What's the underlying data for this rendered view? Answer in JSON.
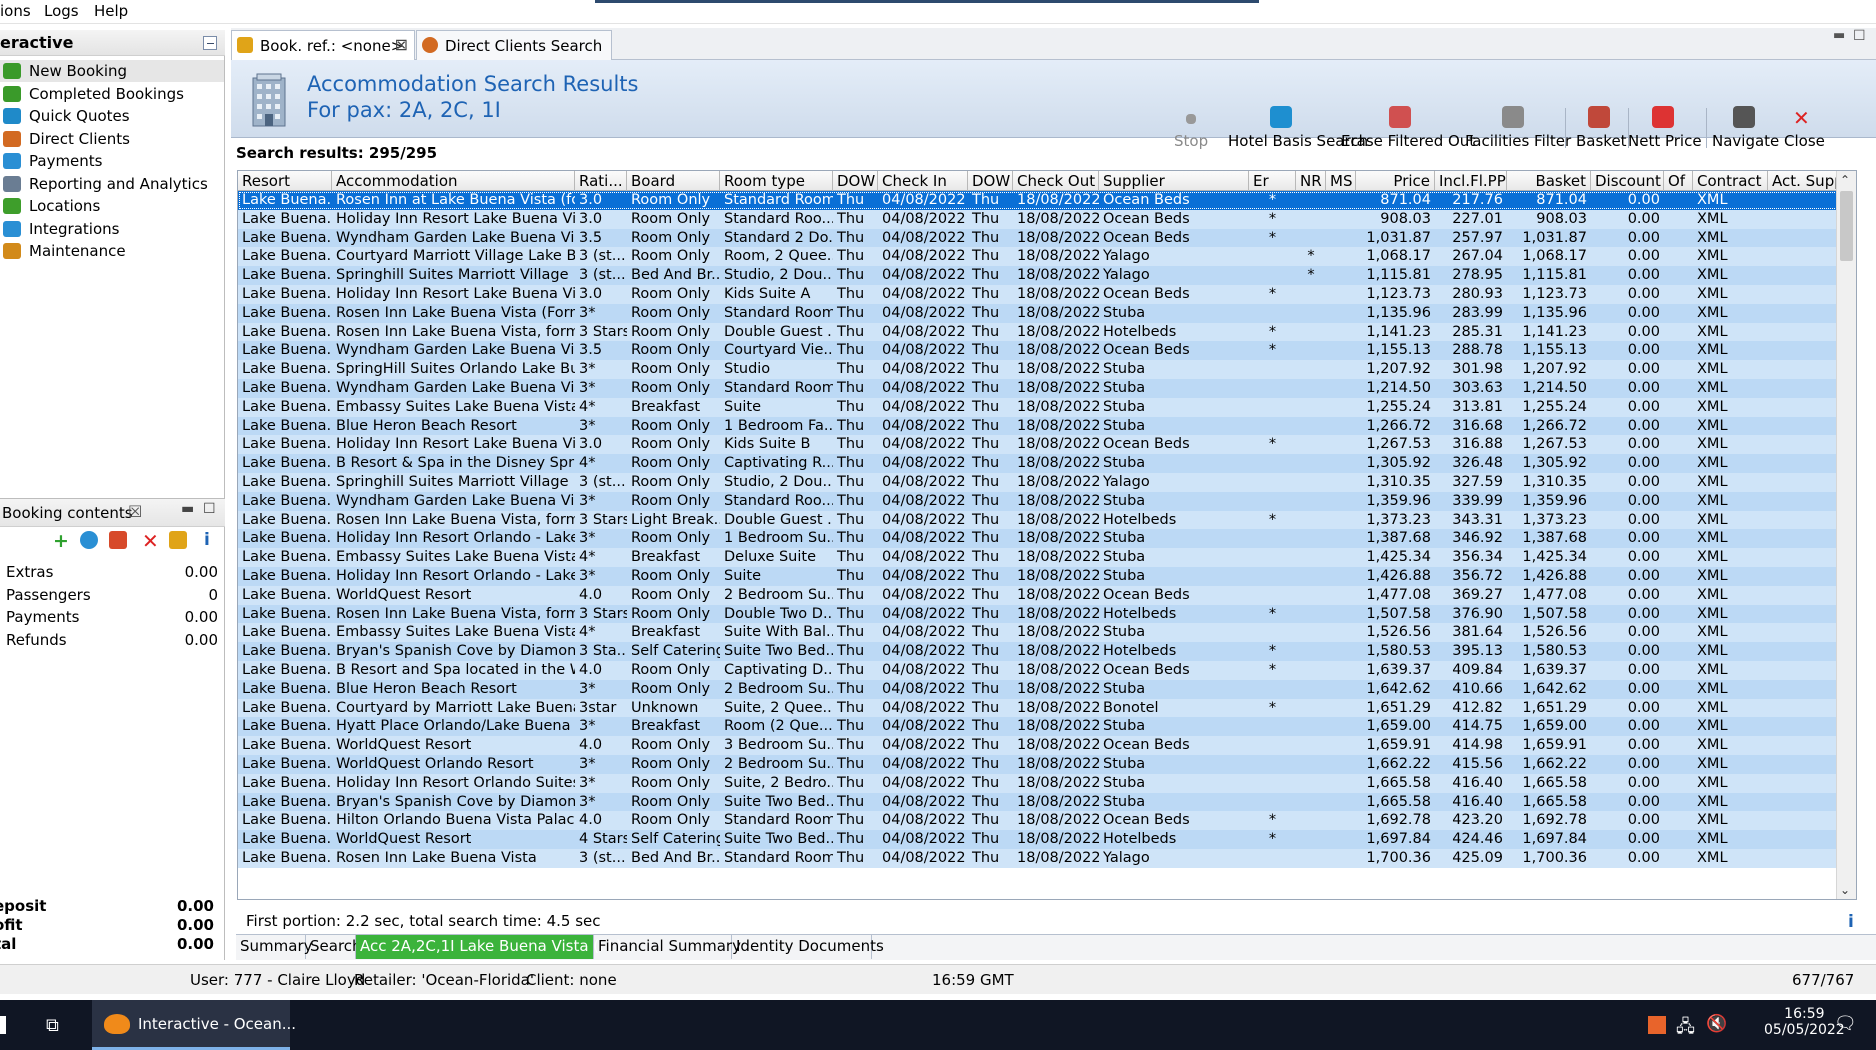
{
  "menu": {
    "items": [
      "ions",
      "Logs",
      "Help"
    ]
  },
  "left_panel": {
    "title": "eractive",
    "nav": [
      {
        "label": "New Booking",
        "icon": "new-booking-icon",
        "selected": true
      },
      {
        "label": "Completed Bookings",
        "icon": "completed-bookings-icon"
      },
      {
        "label": "Quick Quotes",
        "icon": "quick-quotes-icon"
      },
      {
        "label": "Direct Clients",
        "icon": "direct-clients-icon"
      },
      {
        "label": "Payments",
        "icon": "payments-icon"
      },
      {
        "label": "Reporting and Analytics",
        "icon": "reporting-icon"
      },
      {
        "label": "Locations",
        "icon": "locations-icon"
      },
      {
        "label": "Integrations",
        "icon": "integrations-icon"
      },
      {
        "label": "Maintenance",
        "icon": "maintenance-icon"
      }
    ]
  },
  "booking_contents": {
    "title": "Booking contents",
    "rows": [
      {
        "label": "Extras",
        "value": "0.00"
      },
      {
        "label": "Passengers",
        "value": "0"
      },
      {
        "label": "Payments",
        "value": "0.00"
      },
      {
        "label": "Refunds",
        "value": "0.00"
      }
    ],
    "totals": [
      {
        "label": "eposit",
        "value": "0.00"
      },
      {
        "label": "ofit",
        "value": "0.00"
      },
      {
        "label": "tal",
        "value": "0.00"
      }
    ]
  },
  "tabs": [
    {
      "label": "Book. ref.: <none>",
      "closable": true,
      "active": true
    },
    {
      "label": "Direct Clients Search",
      "closable": false,
      "active": false
    }
  ],
  "banner": {
    "title": "Accommodation Search Results",
    "subtitle": "For pax: 2A, 2C, 1I"
  },
  "toolbar": [
    {
      "label": "Stop",
      "icon": "stop-icon",
      "disabled": true
    },
    {
      "label": "Hotel Basis Search",
      "icon": "hotel-basis-search-icon"
    },
    {
      "label": "Erase Filtered Out",
      "icon": "erase-filtered-icon"
    },
    {
      "label": "Facilities Filter",
      "icon": "facilities-filter-icon"
    },
    {
      "label": "Basket",
      "icon": "basket-icon"
    },
    {
      "label": "Nett Price",
      "icon": "nett-price-icon"
    },
    {
      "label": "Navigate",
      "icon": "navigate-icon"
    },
    {
      "label": "Close",
      "icon": "close-icon"
    }
  ],
  "results_label": "Search results: 295/295",
  "grid": {
    "columns": [
      "Resort",
      "Accommodation",
      "Rati...",
      "Board",
      "Room type",
      "DOW",
      "Check In",
      "DOW",
      "Check Out",
      "Supplier",
      "Er",
      "NR",
      "MS",
      "Price",
      "Incl.Fl.PP",
      "Basket",
      "Discount",
      "Of",
      "Contract",
      "Act. Supplier"
    ],
    "rows": [
      [
        "Lake Buena...",
        "Rosen Inn at Lake Buena Vista (for...",
        "3.0",
        "Room Only",
        "Standard Room",
        "Thu",
        "04/08/2022",
        "Thu",
        "18/08/2022",
        "Ocean Beds",
        "*",
        "",
        "",
        "871.04",
        "217.76",
        "871.04",
        "0.00",
        "",
        "XML",
        ""
      ],
      [
        "Lake Buena...",
        "Holiday Inn Resort Lake Buena Vista",
        "3.0",
        "Room Only",
        "Standard Roo...",
        "Thu",
        "04/08/2022",
        "Thu",
        "18/08/2022",
        "Ocean Beds",
        "*",
        "",
        "",
        "908.03",
        "227.01",
        "908.03",
        "0.00",
        "",
        "XML",
        ""
      ],
      [
        "Lake Buena...",
        "Wyndham Garden Lake Buena Vis...",
        "3.5",
        "Room Only",
        "Standard 2 Do...",
        "Thu",
        "04/08/2022",
        "Thu",
        "18/08/2022",
        "Ocean Beds",
        "*",
        "",
        "",
        "1,031.87",
        "257.97",
        "1,031.87",
        "0.00",
        "",
        "XML",
        ""
      ],
      [
        "Lake Buena...",
        "Courtyard Marriott Village Lake B...",
        "3 (st...",
        "Room Only",
        "Room, 2 Quee...",
        "Thu",
        "04/08/2022",
        "Thu",
        "18/08/2022",
        "Yalago",
        "",
        "*",
        "",
        "1,068.17",
        "267.04",
        "1,068.17",
        "0.00",
        "",
        "XML",
        ""
      ],
      [
        "Lake Buena...",
        "Springhill Suites Marriott Village",
        "3 (st...",
        "Bed And Br...",
        "Studio, 2 Dou...",
        "Thu",
        "04/08/2022",
        "Thu",
        "18/08/2022",
        "Yalago",
        "",
        "*",
        "",
        "1,115.81",
        "278.95",
        "1,115.81",
        "0.00",
        "",
        "XML",
        ""
      ],
      [
        "Lake Buena...",
        "Holiday Inn Resort Lake Buena Vista",
        "3.0",
        "Room Only",
        "Kids Suite A",
        "Thu",
        "04/08/2022",
        "Thu",
        "18/08/2022",
        "Ocean Beds",
        "*",
        "",
        "",
        "1,123.73",
        "280.93",
        "1,123.73",
        "0.00",
        "",
        "XML",
        ""
      ],
      [
        "Lake Buena...",
        "Rosen Inn Lake Buena Vista (Form...",
        "3*",
        "Room Only",
        "Standard Room",
        "Thu",
        "04/08/2022",
        "Thu",
        "18/08/2022",
        "Stuba",
        "",
        "",
        "",
        "1,135.96",
        "283.99",
        "1,135.96",
        "0.00",
        "",
        "XML",
        ""
      ],
      [
        "Lake Buena...",
        "Rosen Inn Lake Buena Vista, form...",
        "3 Stars",
        "Room Only",
        "Double Guest ...",
        "Thu",
        "04/08/2022",
        "Thu",
        "18/08/2022",
        "Hotelbeds",
        "*",
        "",
        "",
        "1,141.23",
        "285.31",
        "1,141.23",
        "0.00",
        "",
        "XML",
        ""
      ],
      [
        "Lake Buena...",
        "Wyndham Garden Lake Buena Vis...",
        "3.5",
        "Room Only",
        "Courtyard Vie...",
        "Thu",
        "04/08/2022",
        "Thu",
        "18/08/2022",
        "Ocean Beds",
        "*",
        "",
        "",
        "1,155.13",
        "288.78",
        "1,155.13",
        "0.00",
        "",
        "XML",
        ""
      ],
      [
        "Lake Buena...",
        "SpringHill Suites Orlando Lake Bu...",
        "3*",
        "Room Only",
        "Studio",
        "Thu",
        "04/08/2022",
        "Thu",
        "18/08/2022",
        "Stuba",
        "",
        "",
        "",
        "1,207.92",
        "301.98",
        "1,207.92",
        "0.00",
        "",
        "XML",
        ""
      ],
      [
        "Lake Buena...",
        "Wyndham Garden Lake Buena Vis...",
        "3*",
        "Room Only",
        "Standard Room",
        "Thu",
        "04/08/2022",
        "Thu",
        "18/08/2022",
        "Stuba",
        "",
        "",
        "",
        "1,214.50",
        "303.63",
        "1,214.50",
        "0.00",
        "",
        "XML",
        ""
      ],
      [
        "Lake Buena...",
        "Embassy Suites Lake Buena Vista ...",
        "4*",
        "Breakfast",
        "Suite",
        "Thu",
        "04/08/2022",
        "Thu",
        "18/08/2022",
        "Stuba",
        "",
        "",
        "",
        "1,255.24",
        "313.81",
        "1,255.24",
        "0.00",
        "",
        "XML",
        ""
      ],
      [
        "Lake Buena...",
        "Blue Heron Beach Resort",
        "3*",
        "Room Only",
        "1 Bedroom Fa...",
        "Thu",
        "04/08/2022",
        "Thu",
        "18/08/2022",
        "Stuba",
        "",
        "",
        "",
        "1,266.72",
        "316.68",
        "1,266.72",
        "0.00",
        "",
        "XML",
        ""
      ],
      [
        "Lake Buena...",
        "Holiday Inn Resort Lake Buena Vista",
        "3.0",
        "Room Only",
        "Kids Suite B",
        "Thu",
        "04/08/2022",
        "Thu",
        "18/08/2022",
        "Ocean Beds",
        "*",
        "",
        "",
        "1,267.53",
        "316.88",
        "1,267.53",
        "0.00",
        "",
        "XML",
        ""
      ],
      [
        "Lake Buena...",
        "B Resort & Spa in the Disney Sprin...",
        "4*",
        "Room Only",
        "Captivating R...",
        "Thu",
        "04/08/2022",
        "Thu",
        "18/08/2022",
        "Stuba",
        "",
        "",
        "",
        "1,305.92",
        "326.48",
        "1,305.92",
        "0.00",
        "",
        "XML",
        ""
      ],
      [
        "Lake Buena...",
        "Springhill Suites Marriott Village",
        "3 (st...",
        "Room Only",
        "Studio, 2 Dou...",
        "Thu",
        "04/08/2022",
        "Thu",
        "18/08/2022",
        "Yalago",
        "",
        "",
        "",
        "1,310.35",
        "327.59",
        "1,310.35",
        "0.00",
        "",
        "XML",
        ""
      ],
      [
        "Lake Buena...",
        "Wyndham Garden Lake Buena Vis...",
        "3*",
        "Room Only",
        "Standard Roo...",
        "Thu",
        "04/08/2022",
        "Thu",
        "18/08/2022",
        "Stuba",
        "",
        "",
        "",
        "1,359.96",
        "339.99",
        "1,359.96",
        "0.00",
        "",
        "XML",
        ""
      ],
      [
        "Lake Buena...",
        "Rosen Inn Lake Buena Vista, form...",
        "3 Stars",
        "Light Break...",
        "Double Guest ...",
        "Thu",
        "04/08/2022",
        "Thu",
        "18/08/2022",
        "Hotelbeds",
        "*",
        "",
        "",
        "1,373.23",
        "343.31",
        "1,373.23",
        "0.00",
        "",
        "XML",
        ""
      ],
      [
        "Lake Buena...",
        "Holiday Inn Resort Orlando - Lake...",
        "3*",
        "Room Only",
        "1 Bedroom Su...",
        "Thu",
        "04/08/2022",
        "Thu",
        "18/08/2022",
        "Stuba",
        "",
        "",
        "",
        "1,387.68",
        "346.92",
        "1,387.68",
        "0.00",
        "",
        "XML",
        ""
      ],
      [
        "Lake Buena...",
        "Embassy Suites Lake Buena Vista ...",
        "4*",
        "Breakfast",
        "Deluxe Suite",
        "Thu",
        "04/08/2022",
        "Thu",
        "18/08/2022",
        "Stuba",
        "",
        "",
        "",
        "1,425.34",
        "356.34",
        "1,425.34",
        "0.00",
        "",
        "XML",
        ""
      ],
      [
        "Lake Buena...",
        "Holiday Inn Resort Orlando - Lake...",
        "3*",
        "Room Only",
        "Suite",
        "Thu",
        "04/08/2022",
        "Thu",
        "18/08/2022",
        "Stuba",
        "",
        "",
        "",
        "1,426.88",
        "356.72",
        "1,426.88",
        "0.00",
        "",
        "XML",
        ""
      ],
      [
        "Lake Buena...",
        "WorldQuest Resort",
        "4.0",
        "Room Only",
        "2 Bedroom Su...",
        "Thu",
        "04/08/2022",
        "Thu",
        "18/08/2022",
        "Ocean Beds",
        "",
        "",
        "",
        "1,477.08",
        "369.27",
        "1,477.08",
        "0.00",
        "",
        "XML",
        ""
      ],
      [
        "Lake Buena...",
        "Rosen Inn Lake Buena Vista, form...",
        "3 Stars",
        "Room Only",
        "Double Two D...",
        "Thu",
        "04/08/2022",
        "Thu",
        "18/08/2022",
        "Hotelbeds",
        "*",
        "",
        "",
        "1,507.58",
        "376.90",
        "1,507.58",
        "0.00",
        "",
        "XML",
        ""
      ],
      [
        "Lake Buena...",
        "Embassy Suites Lake Buena Vista ...",
        "4*",
        "Breakfast",
        "Suite With Bal...",
        "Thu",
        "04/08/2022",
        "Thu",
        "18/08/2022",
        "Stuba",
        "",
        "",
        "",
        "1,526.56",
        "381.64",
        "1,526.56",
        "0.00",
        "",
        "XML",
        ""
      ],
      [
        "Lake Buena...",
        "Bryan's Spanish Cove by Diamon...",
        "3 Sta...",
        "Self Catering",
        "Suite Two Bed...",
        "Thu",
        "04/08/2022",
        "Thu",
        "18/08/2022",
        "Hotelbeds",
        "*",
        "",
        "",
        "1,580.53",
        "395.13",
        "1,580.53",
        "0.00",
        "",
        "XML",
        ""
      ],
      [
        "Lake Buena...",
        "B Resort and Spa located in the W...",
        "4.0",
        "Room Only",
        "Captivating D...",
        "Thu",
        "04/08/2022",
        "Thu",
        "18/08/2022",
        "Ocean Beds",
        "*",
        "",
        "",
        "1,639.37",
        "409.84",
        "1,639.37",
        "0.00",
        "",
        "XML",
        ""
      ],
      [
        "Lake Buena...",
        "Blue Heron Beach Resort",
        "3*",
        "Room Only",
        "2 Bedroom Su...",
        "Thu",
        "04/08/2022",
        "Thu",
        "18/08/2022",
        "Stuba",
        "",
        "",
        "",
        "1,642.62",
        "410.66",
        "1,642.62",
        "0.00",
        "",
        "XML",
        ""
      ],
      [
        "Lake Buena...",
        "Courtyard by Marriott Lake Buena...",
        "3star",
        "Unknown",
        "Suite, 2 Quee...",
        "Thu",
        "04/08/2022",
        "Thu",
        "18/08/2022",
        "Bonotel",
        "*",
        "",
        "",
        "1,651.29",
        "412.82",
        "1,651.29",
        "0.00",
        "",
        "XML",
        ""
      ],
      [
        "Lake Buena...",
        "Hyatt Place Orlando/Lake Buena ...",
        "3*",
        "Breakfast",
        "Room (2 Que...",
        "Thu",
        "04/08/2022",
        "Thu",
        "18/08/2022",
        "Stuba",
        "",
        "",
        "",
        "1,659.00",
        "414.75",
        "1,659.00",
        "0.00",
        "",
        "XML",
        ""
      ],
      [
        "Lake Buena...",
        "WorldQuest Resort",
        "4.0",
        "Room Only",
        "3 Bedroom Su...",
        "Thu",
        "04/08/2022",
        "Thu",
        "18/08/2022",
        "Ocean Beds",
        "",
        "",
        "",
        "1,659.91",
        "414.98",
        "1,659.91",
        "0.00",
        "",
        "XML",
        ""
      ],
      [
        "Lake Buena...",
        "WorldQuest Orlando Resort",
        "3*",
        "Room Only",
        "2 Bedroom Su...",
        "Thu",
        "04/08/2022",
        "Thu",
        "18/08/2022",
        "Stuba",
        "",
        "",
        "",
        "1,662.22",
        "415.56",
        "1,662.22",
        "0.00",
        "",
        "XML",
        ""
      ],
      [
        "Lake Buena...",
        "Holiday Inn Resort Orlando Suites...",
        "3*",
        "Room Only",
        "Suite, 2 Bedro...",
        "Thu",
        "04/08/2022",
        "Thu",
        "18/08/2022",
        "Stuba",
        "",
        "",
        "",
        "1,665.58",
        "416.40",
        "1,665.58",
        "0.00",
        "",
        "XML",
        ""
      ],
      [
        "Lake Buena...",
        "Bryan's Spanish Cove by Diamon...",
        "3*",
        "Room Only",
        "Suite Two Bed...",
        "Thu",
        "04/08/2022",
        "Thu",
        "18/08/2022",
        "Stuba",
        "",
        "",
        "",
        "1,665.58",
        "416.40",
        "1,665.58",
        "0.00",
        "",
        "XML",
        ""
      ],
      [
        "Lake Buena...",
        "Hilton Orlando Buena Vista Palace",
        "4.0",
        "Room Only",
        "Standard Room",
        "Thu",
        "04/08/2022",
        "Thu",
        "18/08/2022",
        "Ocean Beds",
        "*",
        "",
        "",
        "1,692.78",
        "423.20",
        "1,692.78",
        "0.00",
        "",
        "XML",
        ""
      ],
      [
        "Lake Buena...",
        "WorldQuest Resort",
        "4 Stars",
        "Self Catering",
        "Suite Two Bed...",
        "Thu",
        "04/08/2022",
        "Thu",
        "18/08/2022",
        "Hotelbeds",
        "*",
        "",
        "",
        "1,697.84",
        "424.46",
        "1,697.84",
        "0.00",
        "",
        "XML",
        ""
      ],
      [
        "Lake Buena...",
        "Rosen Inn Lake Buena Vista",
        "3 (st...",
        "Bed And Br...",
        "Standard Room",
        "Thu",
        "04/08/2022",
        "Thu",
        "18/08/2022",
        "Yalago",
        "",
        "",
        "",
        "1,700.36",
        "425.09",
        "1,700.36",
        "0.00",
        "",
        "XML",
        ""
      ]
    ],
    "selected_row": 0
  },
  "timing": "First portion: 2.2 sec, total search time: 4.5 sec",
  "bottom_tabs": [
    "Summary",
    "Search",
    "Acc 2A,2C,1I Lake Buena Vista (FL)",
    "Financial Summary",
    "Identity Documents"
  ],
  "bottom_active": 2,
  "status": {
    "user": "User: 777 - Claire Lloyd",
    "retailer": "Retailer: 'Ocean-Florida'",
    "client": "Client: none",
    "time": "16:59 GMT",
    "memory": "677/767"
  },
  "taskbar": {
    "app_label": "Interactive - Ocean...",
    "clock_time": "16:59",
    "clock_date": "05/05/2022"
  },
  "colors": {
    "selected_row": "#0a6fd6",
    "row_alt_a": "#bcd9f5",
    "row_alt_b": "#cfe4f8",
    "accent_title": "#1e63b4",
    "active_bottom_tab": "#3bb33b"
  }
}
